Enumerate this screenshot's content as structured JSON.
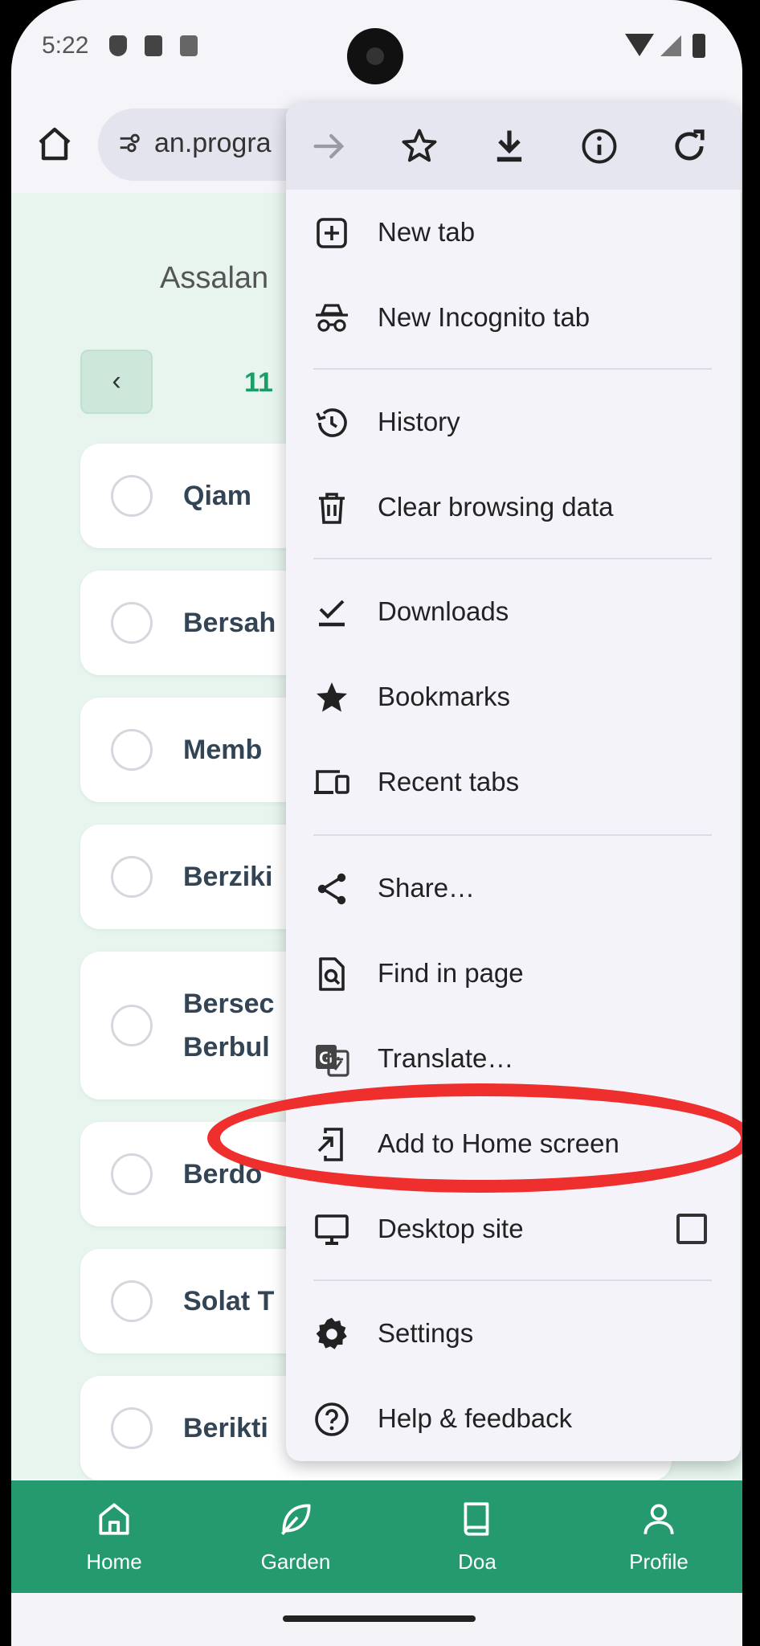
{
  "status_bar": {
    "time": "5:22"
  },
  "browser": {
    "url": "an.progra"
  },
  "page": {
    "greeting": "Assalan",
    "date_fragment": "11",
    "back_label": "‹",
    "tasks": [
      {
        "label": "Qiam"
      },
      {
        "label": "Bersah"
      },
      {
        "label": "Memb"
      },
      {
        "label": "Berziki"
      },
      {
        "label_line1": "Bersec",
        "label_line2": "Berbul"
      },
      {
        "label": "Berdo"
      },
      {
        "label": "Solat T"
      },
      {
        "label": "Berikti"
      }
    ]
  },
  "bottom_nav": {
    "items": [
      {
        "label": "Home",
        "icon": "home-icon"
      },
      {
        "label": "Garden",
        "icon": "leaf-icon"
      },
      {
        "label": "Doa",
        "icon": "book-icon"
      },
      {
        "label": "Profile",
        "icon": "person-icon"
      }
    ]
  },
  "menu": {
    "top_icons": [
      "forward-icon",
      "star-icon",
      "download-icon",
      "info-icon",
      "refresh-icon"
    ],
    "items": [
      {
        "label": "New tab",
        "icon": "new-tab-icon"
      },
      {
        "label": "New Incognito tab",
        "icon": "incognito-icon"
      },
      {
        "label": "History",
        "icon": "history-icon"
      },
      {
        "label": "Clear browsing data",
        "icon": "trash-icon"
      },
      {
        "label": "Downloads",
        "icon": "downloads-icon"
      },
      {
        "label": "Bookmarks",
        "icon": "bookmark-star-icon"
      },
      {
        "label": "Recent tabs",
        "icon": "devices-icon"
      },
      {
        "label": "Share…",
        "icon": "share-icon"
      },
      {
        "label": "Find in page",
        "icon": "find-icon"
      },
      {
        "label": "Translate…",
        "icon": "translate-icon"
      },
      {
        "label": "Add to Home screen",
        "icon": "add-to-home-icon"
      },
      {
        "label": "Desktop site",
        "icon": "desktop-icon",
        "checked": false
      },
      {
        "label": "Settings",
        "icon": "settings-icon"
      },
      {
        "label": "Help & feedback",
        "icon": "help-icon"
      }
    ]
  },
  "annotation": {
    "color": "#ef2e2e"
  }
}
